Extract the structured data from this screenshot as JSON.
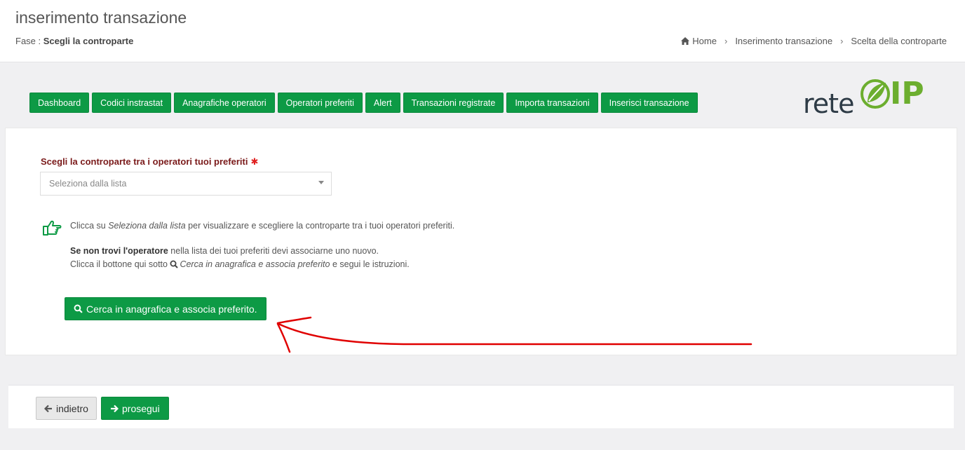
{
  "header": {
    "title": "inserimento transazione",
    "phase_label": "Fase :",
    "phase_value": "Scegli la controparte",
    "breadcrumb": [
      "Home",
      "Inserimento transazione",
      "Scelta della controparte"
    ]
  },
  "nav": {
    "items": [
      "Dashboard",
      "Codici instrastat",
      "Anagrafiche operatori",
      "Operatori preferiti",
      "Alert",
      "Transazioni registrate",
      "Importa transazioni",
      "Inserisci transazione"
    ]
  },
  "logo": {
    "text_left": "rete",
    "text_right": "IP"
  },
  "form": {
    "label": "Scegli la controparte tra i operatori tuoi preferiti",
    "required_mark": "✱",
    "select_placeholder": "Seleziona dalla lista"
  },
  "help": {
    "line1_a": "Clicca su ",
    "line1_b": "Seleziona dalla lista",
    "line1_c": " per visualizzare e scegliere la controparte tra i tuoi operatori preferiti.",
    "line2_bold": "Se non trovi l'operatore",
    "line2_rest": " nella lista dei tuoi preferiti devi associarne uno nuovo.",
    "line3_a": "Clicca il bottone qui sotto ",
    "line3_b": "Cerca in anagrafica e associa preferito",
    "line3_c": " e segui le istruzioni."
  },
  "search_button": "Cerca in anagrafica e associa preferito.",
  "footer": {
    "back_label": "indietro",
    "next_label": "prosegui"
  },
  "colors": {
    "primary_green": "#0d9a45",
    "annotation_red": "#e00000",
    "label_red": "#7a1a1a"
  },
  "icons": [
    "home-icon",
    "hand-pointing-right-icon",
    "search-icon",
    "arrow-left-icon",
    "arrow-right-icon"
  ]
}
